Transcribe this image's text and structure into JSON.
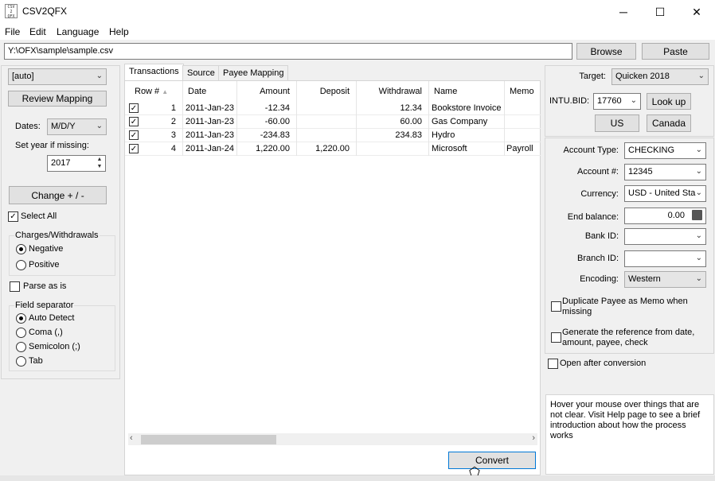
{
  "window": {
    "title": "CSV2QFX",
    "icon": "app-icon",
    "minimize": "─",
    "maximize": "☐",
    "close": "✕"
  },
  "menu": [
    "File",
    "Edit",
    "Language",
    "Help"
  ],
  "path": {
    "value": "Y:\\OFX\\sample\\sample.csv",
    "browse": "Browse",
    "paste": "Paste"
  },
  "left": {
    "mapping_combo": "[auto]",
    "review_mapping": "Review Mapping",
    "dates_label": "Dates:",
    "dates_value": "M/D/Y",
    "set_year_label": "Set year if missing:",
    "year_value": "2017",
    "change_sign": "Change + / -",
    "select_all": "Select All",
    "charges_title": "Charges/Withdrawals",
    "negative": "Negative",
    "positive": "Positive",
    "parse_as_is": "Parse as is",
    "field_sep_title": "Field separator",
    "auto_detect": "Auto Detect",
    "coma": "Coma (,)",
    "semicolon": "Semicolon (;)",
    "tab": "Tab"
  },
  "tabs": [
    "Transactions",
    "Source",
    "Payee Mapping"
  ],
  "grid": {
    "columns": [
      "Row #",
      "Date",
      "Amount",
      "Deposit",
      "Withdrawal",
      "Name",
      "Memo"
    ],
    "rows": [
      {
        "row": "1",
        "date": "2011-Jan-23",
        "amount": "-12.34",
        "deposit": "",
        "withdrawal": "12.34",
        "name": "Bookstore Invoice",
        "memo": ""
      },
      {
        "row": "2",
        "date": "2011-Jan-23",
        "amount": "-60.00",
        "deposit": "",
        "withdrawal": "60.00",
        "name": "Gas Company",
        "memo": ""
      },
      {
        "row": "3",
        "date": "2011-Jan-23",
        "amount": "-234.83",
        "deposit": "",
        "withdrawal": "234.83",
        "name": "Hydro",
        "memo": ""
      },
      {
        "row": "4",
        "date": "2011-Jan-24",
        "amount": "1,220.00",
        "deposit": "1,220.00",
        "withdrawal": "",
        "name": "Microsoft",
        "memo": "Payroll"
      }
    ]
  },
  "convert": "Convert",
  "right": {
    "target_label": "Target:",
    "target_value": "Quicken 2018",
    "intu_label": "INTU.BID:",
    "intu_value": "17760",
    "lookup": "Look up",
    "us": "US",
    "canada": "Canada",
    "account_type_label": "Account Type:",
    "account_type_value": "CHECKING",
    "account_num_label": "Account #:",
    "account_num_value": "12345",
    "currency_label": "Currency:",
    "currency_value": "USD - United Sta",
    "end_balance_label": "End balance:",
    "end_balance_value": "0.00",
    "bank_id_label": "Bank ID:",
    "branch_id_label": "Branch ID:",
    "encoding_label": "Encoding:",
    "encoding_value": "Western",
    "dup_payee": "Duplicate Payee as Memo when missing",
    "gen_ref": "Generate the reference from date, amount, payee, check",
    "open_after": "Open after conversion",
    "help_text": "Hover your mouse over things that are not clear. Visit Help page to see a brief introduction about how the process works"
  }
}
